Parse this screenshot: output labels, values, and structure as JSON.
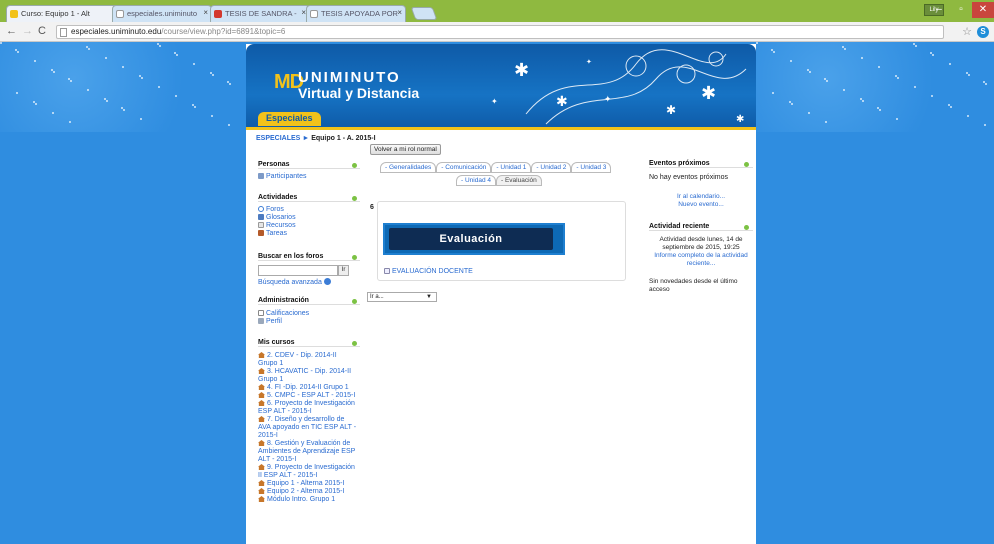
{
  "browser": {
    "tabs": [
      {
        "label": "Curso: Equipo 1 - Alt",
        "active": true
      },
      {
        "label": "especiales.uniminuto",
        "active": false
      },
      {
        "label": "TESIS DE SANDRA - ",
        "active": false
      },
      {
        "label": "TESIS APOYADA POR",
        "active": false
      }
    ],
    "user_badge": "Lily",
    "url_host": "especiales.uniminuto.edu",
    "url_path": "/course/view.php?id=6891&topic=6"
  },
  "site": {
    "logo_mark": "MD",
    "logo_name": "UNIMINUTO",
    "logo_sub": "Virtual y Distancia",
    "site_tab": "Especiales",
    "breadcrumb_root": "ESPECIALES",
    "breadcrumb_sep": "►",
    "breadcrumb_current": "Equipo 1 - A. 2015-I",
    "role_button": "Volver a mi rol normal"
  },
  "left": {
    "personas": {
      "title": "Personas",
      "items": [
        "Participantes"
      ]
    },
    "actividades": {
      "title": "Actividades",
      "items": [
        "Foros",
        "Glosarios",
        "Recursos",
        "Tareas"
      ]
    },
    "buscar": {
      "title": "Buscar en los foros",
      "button": "Ir",
      "advanced": "Búsqueda avanzada"
    },
    "administracion": {
      "title": "Administración",
      "items": [
        "Calificaciones",
        "Perfil"
      ]
    },
    "mis_cursos": {
      "title": "Mis cursos",
      "items": [
        "2. CDEV - Dip. 2014-II Grupo 1",
        "3. HCAVATIC - Dip. 2014-II Grupo 1",
        "4. FI -Dip. 2014-II Grupo 1",
        "5. CMPC - ESP ALT - 2015-I",
        "6. Proyecto de Investigación ESP ALT - 2015-I",
        "7. Diseño y desarrollo de AVA apoyado en TIC ESP ALT - 2015-I",
        "8. Gestión y Evaluación de Ambientes de Aprendizaje ESP ALT - 2015-I",
        "9. Proyecto de Investigación II ESP ALT - 2015-I",
        "Equipo 1 - Alterna 2015-I",
        "Equipo 2 - Alterna 2015-I",
        "Módulo Intro. Grupo 1"
      ]
    }
  },
  "center": {
    "tabs_row1": [
      "- Generalidades",
      "- Comunicación",
      "- Unidad 1",
      "- Unidad 2",
      "- Unidad 3"
    ],
    "tabs_row2": [
      "- Unidad 4",
      "- Evaluación"
    ],
    "selected_tab": "- Evaluación",
    "section_number": "6",
    "banner_text": "Evaluación",
    "resource_link": "EVALUACIÓN DOCENTE",
    "jump_label": "Ir a..."
  },
  "right": {
    "eventos": {
      "title": "Eventos próximos",
      "empty": "No hay eventos próximos",
      "links": [
        "Ir al calendario...",
        "Nuevo evento..."
      ]
    },
    "actividad": {
      "title": "Actividad reciente",
      "since": "Actividad desde lunes, 14 de septiembre de 2015, 19:25",
      "full_report": "Informe completo de la actividad reciente...",
      "no_news": "Sin novedades desde el último acceso"
    }
  },
  "colors": {
    "accent_yellow": "#f2c21a",
    "brand_blue": "#0e5aa7",
    "link_blue": "#2a6bd0",
    "block_dot": "#7cc244"
  }
}
